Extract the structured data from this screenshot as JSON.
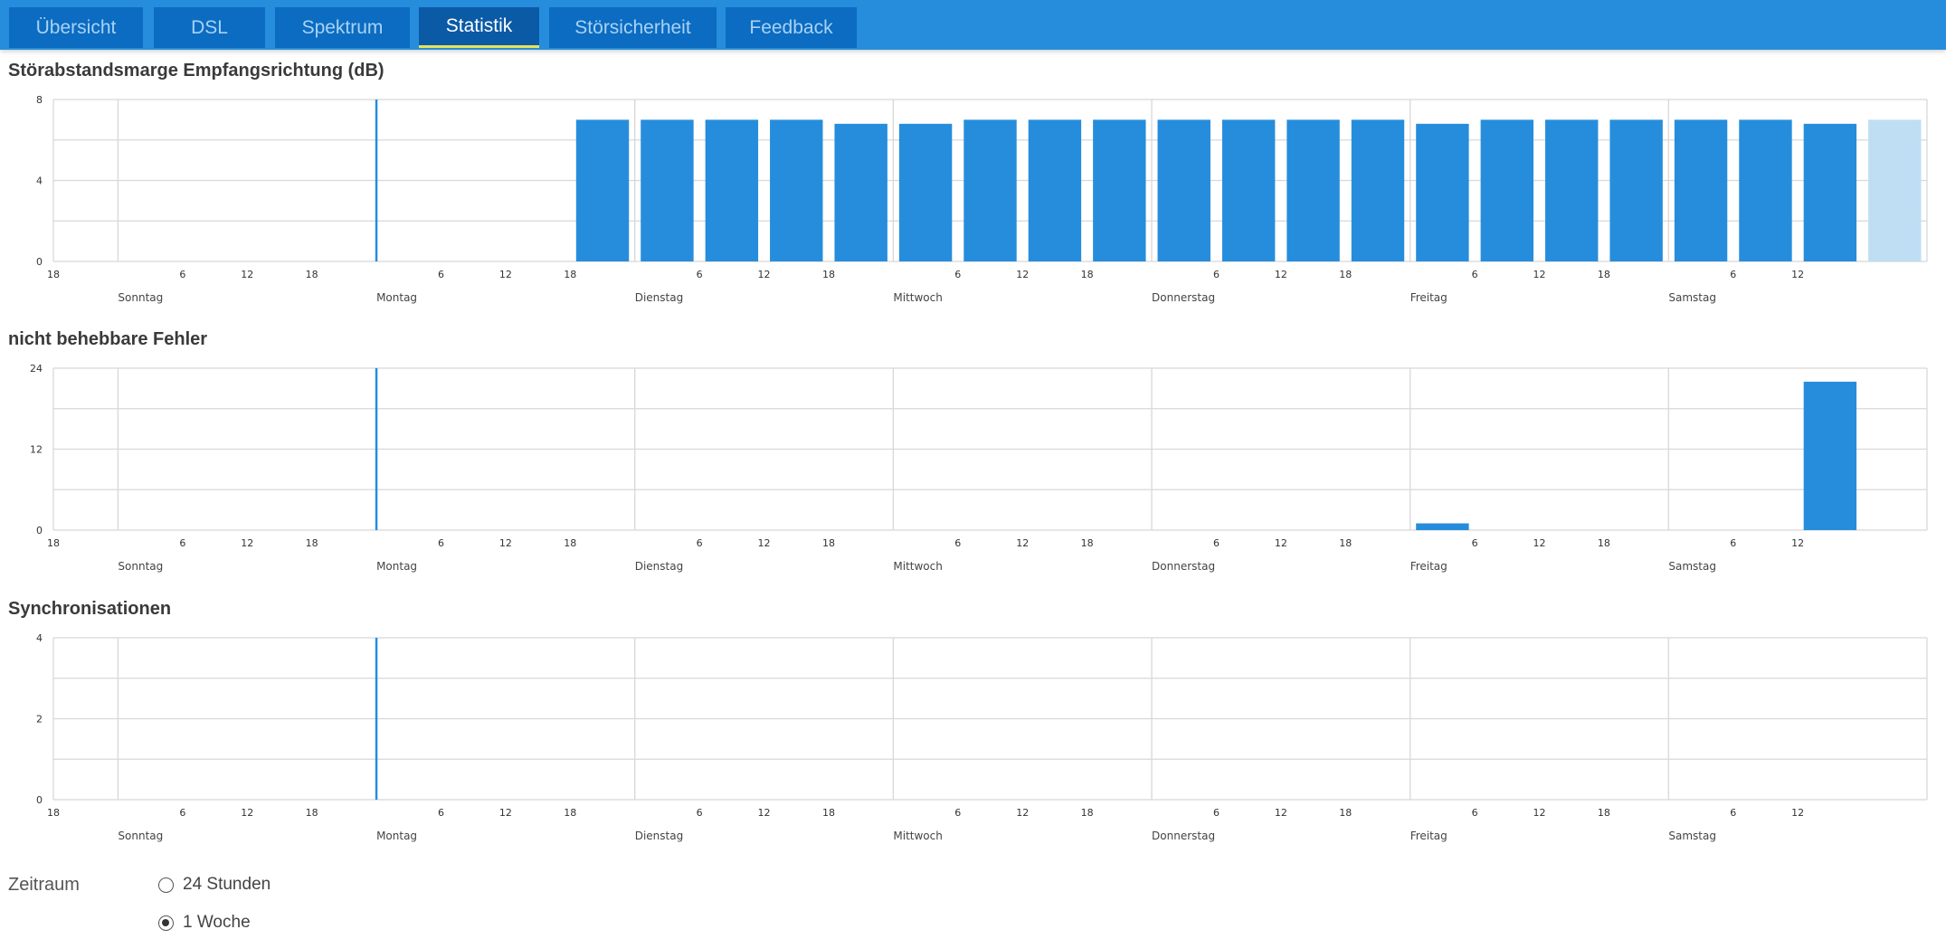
{
  "tabs": [
    {
      "label": "Übersicht",
      "active": false
    },
    {
      "label": "DSL",
      "active": false
    },
    {
      "label": "Spektrum",
      "active": false
    },
    {
      "label": "Statistik",
      "active": true
    },
    {
      "label": "Störsicherheit",
      "active": false
    },
    {
      "label": "Feedback",
      "active": false
    }
  ],
  "colors": {
    "accent": "#268ddc",
    "bar": "#268ddc",
    "bar_current": "#bfdef4",
    "marker": "#268ddc",
    "tab_bg": "#0b6cc2",
    "tab_active_bg": "#0a5aa6",
    "tab_active_underline": "#e6e35a"
  },
  "chart_data": [
    {
      "type": "bar",
      "title": "Störabstandsmarge Empfangsrichtung (dB)",
      "ylim": [
        0,
        8
      ],
      "yticks": [
        "0",
        "4",
        "8"
      ],
      "hour_tick_labels": [
        "18",
        "6",
        "12",
        "18",
        "6",
        "12",
        "18",
        "6",
        "12",
        "18",
        "6",
        "12",
        "18",
        "6",
        "12",
        "18",
        "6",
        "12",
        "18",
        "6",
        "12"
      ],
      "day_labels": [
        "Sonntag",
        "Montag",
        "Dienstag",
        "Mittwoch",
        "Donnerstag",
        "Freitag",
        "Samstag"
      ],
      "x_unit": "hours since Saturday 18:00",
      "marker_x": 30,
      "bars": [
        {
          "x_start": 48,
          "value": 7.0
        },
        {
          "x_start": 54,
          "value": 7.0
        },
        {
          "x_start": 60,
          "value": 7.0
        },
        {
          "x_start": 66,
          "value": 7.0
        },
        {
          "x_start": 72,
          "value": 6.8
        },
        {
          "x_start": 78,
          "value": 6.8
        },
        {
          "x_start": 84,
          "value": 7.0
        },
        {
          "x_start": 90,
          "value": 7.0
        },
        {
          "x_start": 96,
          "value": 7.0
        },
        {
          "x_start": 102,
          "value": 7.0
        },
        {
          "x_start": 108,
          "value": 7.0
        },
        {
          "x_start": 114,
          "value": 7.0
        },
        {
          "x_start": 120,
          "value": 7.0
        },
        {
          "x_start": 126,
          "value": 6.8
        },
        {
          "x_start": 132,
          "value": 7.0
        },
        {
          "x_start": 138,
          "value": 7.0
        },
        {
          "x_start": 144,
          "value": 7.0
        },
        {
          "x_start": 150,
          "value": 7.0
        },
        {
          "x_start": 156,
          "value": 7.0
        },
        {
          "x_start": 162,
          "value": 6.8
        },
        {
          "x_start": 168,
          "value": 7.0,
          "current": true
        }
      ]
    },
    {
      "type": "bar",
      "title": "nicht behebbare Fehler",
      "ylim": [
        0,
        24
      ],
      "yticks": [
        "0",
        "12",
        "24"
      ],
      "hour_tick_labels": [
        "18",
        "6",
        "12",
        "18",
        "6",
        "12",
        "18",
        "6",
        "12",
        "18",
        "6",
        "12",
        "18",
        "6",
        "12",
        "18",
        "6",
        "12",
        "18",
        "6",
        "12"
      ],
      "day_labels": [
        "Sonntag",
        "Montag",
        "Dienstag",
        "Mittwoch",
        "Donnerstag",
        "Freitag",
        "Samstag"
      ],
      "x_unit": "hours since Saturday 18:00",
      "marker_x": 30,
      "bars": [
        {
          "x_start": 126,
          "value": 1
        },
        {
          "x_start": 162,
          "value": 22
        }
      ]
    },
    {
      "type": "bar",
      "title": "Synchronisationen",
      "ylim": [
        0,
        4
      ],
      "yticks": [
        "0",
        "2",
        "4"
      ],
      "hour_tick_labels": [
        "18",
        "6",
        "12",
        "18",
        "6",
        "12",
        "18",
        "6",
        "12",
        "18",
        "6",
        "12",
        "18",
        "6",
        "12",
        "18",
        "6",
        "12",
        "18",
        "6",
        "12"
      ],
      "day_labels": [
        "Sonntag",
        "Montag",
        "Dienstag",
        "Mittwoch",
        "Donnerstag",
        "Freitag",
        "Samstag"
      ],
      "x_unit": "hours since Saturday 18:00",
      "marker_x": 30,
      "bars": []
    }
  ],
  "timeframe": {
    "label": "Zeitraum",
    "options": [
      {
        "label": "24 Stunden",
        "checked": false
      },
      {
        "label": "1 Woche",
        "checked": true
      }
    ]
  }
}
